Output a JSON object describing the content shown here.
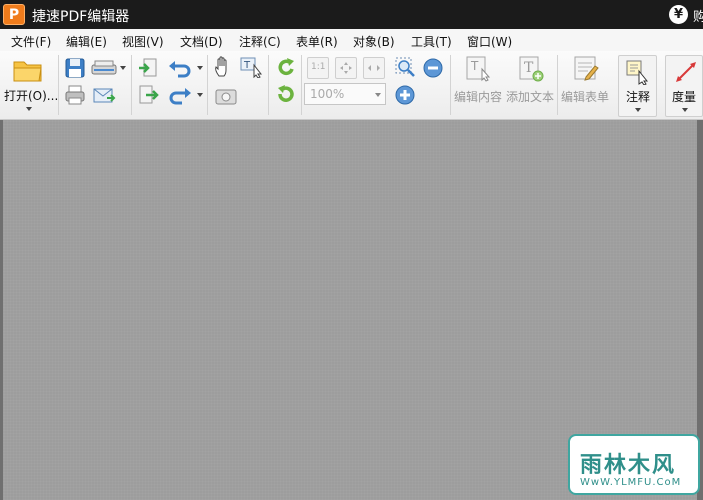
{
  "app": {
    "title": "捷速PDF编辑器",
    "logo_letter": "P",
    "currency_symbol": "¥",
    "buy_label": "购"
  },
  "menu": [
    "文件(F)",
    "编辑(E)",
    "视图(V)",
    "文档(D)",
    "注释(C)",
    "表单(R)",
    "对象(B)",
    "工具(T)",
    "窗口(W)"
  ],
  "toolbar": {
    "open_label": "打开(O)...",
    "zoom_value": "100%",
    "edit_content_label": "编辑内容",
    "add_text_label": "添加文本",
    "edit_form_label": "编辑表单",
    "annotate_label": "注释",
    "measure_label": "度量"
  },
  "watermark": {
    "text": "雨林木风",
    "url": "WwW.YLMFU.CoM"
  },
  "colors": {
    "title_bar": "#1b1b1b",
    "logo": "#f07c1c",
    "document_background": "#9d9d9d",
    "watermark": "#2f8f8a"
  }
}
